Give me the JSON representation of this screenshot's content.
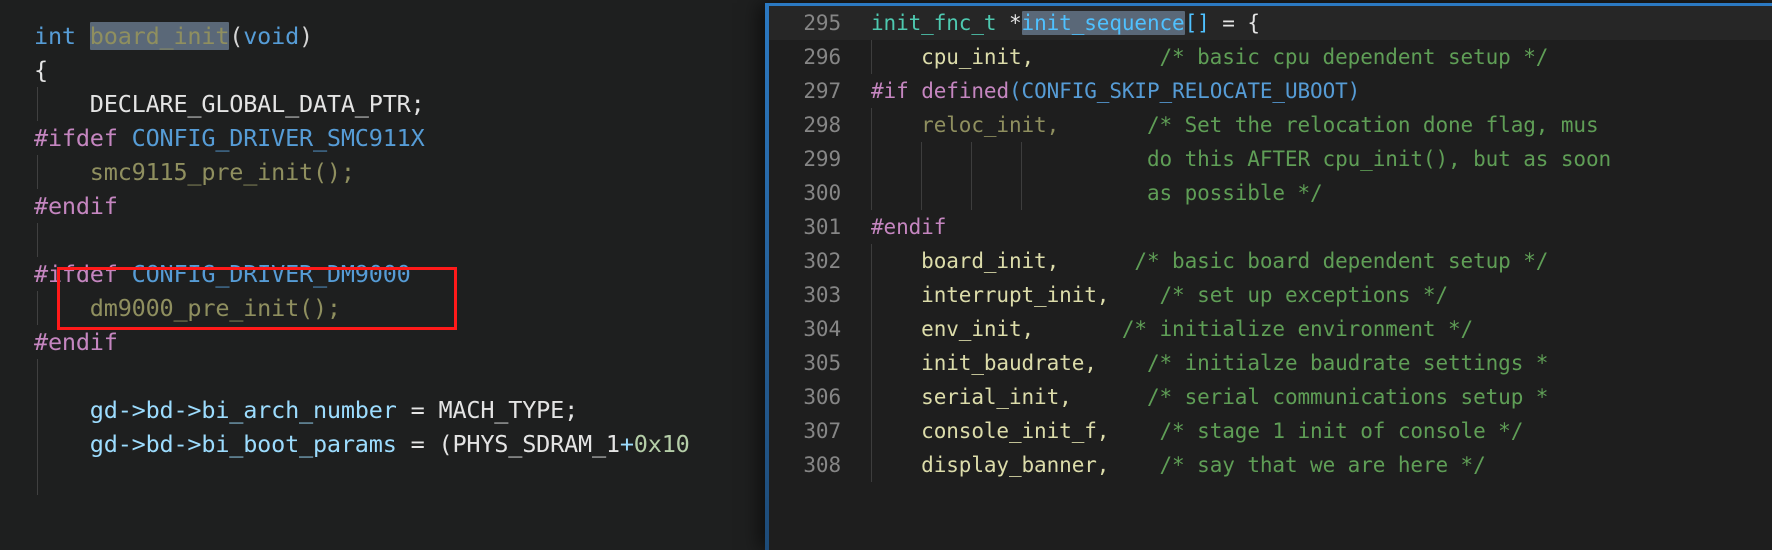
{
  "app": {
    "kind": "code-editor",
    "theme": "dark",
    "colors": {
      "background": "#1e1e1e",
      "left_background": "#1e1f1f",
      "peek_border": "#2b79c2",
      "annotation": "#ff1a1a",
      "selection_highlight": "#5a6878",
      "line_number": "#868686",
      "comment": "#5f9e56",
      "preprocessor": "#c586c0",
      "macro": "#569cd6",
      "function_name": "#dcdcaa",
      "typedef": "#4ec9b0",
      "variable": "#9cdcfe",
      "call": "#8f8f5f",
      "plain": "#d4d4d4"
    }
  },
  "left_editor": {
    "name": "board_init source",
    "highlighted_symbol": "board_init",
    "lines": [
      {
        "indent_guides": [],
        "tokens": [
          {
            "t": "int ",
            "c": "k-type"
          },
          {
            "t": "board_init",
            "c": "k-call",
            "hl": true
          },
          {
            "t": "(",
            "c": "k-punct"
          },
          {
            "t": "void",
            "c": "k-type"
          },
          {
            "t": ")",
            "c": "k-punct"
          }
        ]
      },
      {
        "indent_guides": [],
        "tokens": [
          {
            "t": "{",
            "c": "k-white"
          }
        ]
      },
      {
        "indent_guides": [
          0
        ],
        "tokens": [
          {
            "t": "    DECLARE_GLOBAL_DATA_PTR;",
            "c": "k-white"
          }
        ]
      },
      {
        "indent_guides": [],
        "tokens": [
          {
            "t": "#ifdef ",
            "c": "k-pre"
          },
          {
            "t": "CONFIG_DRIVER_SMC911X",
            "c": "k-macro"
          }
        ]
      },
      {
        "indent_guides": [
          0
        ],
        "tokens": [
          {
            "t": "    smc9115_pre_init();",
            "c": "k-call"
          }
        ]
      },
      {
        "indent_guides": [],
        "tokens": [
          {
            "t": "#endif",
            "c": "k-pre"
          }
        ]
      },
      {
        "indent_guides": [
          0
        ],
        "tokens": [
          {
            "t": "",
            "c": "k-plain"
          }
        ]
      },
      {
        "indent_guides": [],
        "tokens": [
          {
            "t": "#ifdef ",
            "c": "k-pre"
          },
          {
            "t": "CONFIG_DRIVER_DM9000",
            "c": "k-macro"
          }
        ]
      },
      {
        "indent_guides": [
          0
        ],
        "tokens": [
          {
            "t": "    dm9000_pre_init();",
            "c": "k-call"
          }
        ]
      },
      {
        "indent_guides": [],
        "tokens": [
          {
            "t": "#endif",
            "c": "k-pre"
          }
        ]
      },
      {
        "indent_guides": [
          0
        ],
        "tokens": [
          {
            "t": "",
            "c": "k-plain"
          }
        ]
      },
      {
        "indent_guides": [
          0
        ],
        "tokens": [
          {
            "t": "    gd->bd->bi_arch_number",
            "c": "k-ident"
          },
          {
            "t": " = ",
            "c": "k-white"
          },
          {
            "t": "MACH_TYPE",
            "c": "k-white"
          },
          {
            "t": ";",
            "c": "k-white"
          }
        ]
      },
      {
        "indent_guides": [
          0
        ],
        "tokens": [
          {
            "t": "    gd->bd->bi_boot_params",
            "c": "k-ident"
          },
          {
            "t": " = ",
            "c": "k-white"
          },
          {
            "t": "(PHYS_SDRAM_1",
            "c": "k-white"
          },
          {
            "t": "+",
            "c": "k-ident"
          },
          {
            "t": "0x10",
            "c": "k-num"
          }
        ]
      },
      {
        "indent_guides": [
          0
        ],
        "tokens": [
          {
            "t": "",
            "c": "k-plain"
          }
        ]
      }
    ]
  },
  "annotation": {
    "name": "red-highlight-rectangle",
    "color": "#ff1a1a",
    "encloses": "#ifdef CONFIG_DRIVER_DM9000 / dm9000_pre_init();"
  },
  "peek_panel": {
    "name": "peek-definition-init_sequence",
    "highlighted_symbol": "init_sequence",
    "current_line": 295,
    "lines": [
      {
        "no": "295",
        "current": true,
        "guides": [],
        "tokens": [
          {
            "t": "init_fnc_t",
            "c": "k-typedef"
          },
          {
            "t": " *",
            "c": "k-white"
          },
          {
            "t": "init_sequence",
            "c": "k-const",
            "hl": true
          },
          {
            "t": "[]",
            "c": "k-const"
          },
          {
            "t": " = ",
            "c": "k-white"
          },
          {
            "t": "{",
            "c": "k-white"
          }
        ]
      },
      {
        "no": "296",
        "current": false,
        "guides": [
          0
        ],
        "tokens": [
          {
            "t": "    cpu_init,",
            "c": "k-fnname"
          },
          {
            "t": "          ",
            "c": "k-plain"
          },
          {
            "t": "/* basic cpu dependent setup */",
            "c": "k-comment"
          }
        ]
      },
      {
        "no": "297",
        "current": false,
        "guides": [],
        "tokens": [
          {
            "t": "#if ",
            "c": "k-pre"
          },
          {
            "t": "defined",
            "c": "k-pre"
          },
          {
            "t": "(",
            "c": "k-macro"
          },
          {
            "t": "CONFIG_SKIP_RELOCATE_UBOOT",
            "c": "k-macro"
          },
          {
            "t": ")",
            "c": "k-macro"
          }
        ]
      },
      {
        "no": "298",
        "current": false,
        "guides": [
          0
        ],
        "tokens": [
          {
            "t": "    reloc_init,",
            "c": "k-call"
          },
          {
            "t": "       ",
            "c": "k-plain"
          },
          {
            "t": "/* Set the relocation done flag, mus",
            "c": "k-comment"
          }
        ]
      },
      {
        "no": "299",
        "current": false,
        "guides": [
          0,
          1,
          2,
          3
        ],
        "tokens": [
          {
            "t": "                      ",
            "c": "k-plain"
          },
          {
            "t": "do this AFTER cpu_init(), but as soon",
            "c": "k-comment"
          }
        ]
      },
      {
        "no": "300",
        "current": false,
        "guides": [
          0,
          1,
          2,
          3
        ],
        "tokens": [
          {
            "t": "                      ",
            "c": "k-plain"
          },
          {
            "t": "as possible */",
            "c": "k-comment"
          }
        ]
      },
      {
        "no": "301",
        "current": false,
        "guides": [],
        "tokens": [
          {
            "t": "#endif",
            "c": "k-pre"
          }
        ]
      },
      {
        "no": "302",
        "current": false,
        "guides": [
          0
        ],
        "tokens": [
          {
            "t": "    board_init,",
            "c": "k-fnname"
          },
          {
            "t": "      ",
            "c": "k-plain"
          },
          {
            "t": "/* basic board dependent setup */",
            "c": "k-comment"
          }
        ]
      },
      {
        "no": "303",
        "current": false,
        "guides": [
          0
        ],
        "tokens": [
          {
            "t": "    interrupt_init,",
            "c": "k-fnname"
          },
          {
            "t": "    ",
            "c": "k-plain"
          },
          {
            "t": "/* set up exceptions */",
            "c": "k-comment"
          }
        ]
      },
      {
        "no": "304",
        "current": false,
        "guides": [
          0
        ],
        "tokens": [
          {
            "t": "    env_init,",
            "c": "k-fnname"
          },
          {
            "t": "       ",
            "c": "k-plain"
          },
          {
            "t": "/* initialize environment */",
            "c": "k-comment"
          }
        ]
      },
      {
        "no": "305",
        "current": false,
        "guides": [
          0
        ],
        "tokens": [
          {
            "t": "    init_baudrate,",
            "c": "k-fnname"
          },
          {
            "t": "    ",
            "c": "k-plain"
          },
          {
            "t": "/* initialze baudrate settings *",
            "c": "k-comment"
          }
        ]
      },
      {
        "no": "306",
        "current": false,
        "guides": [
          0
        ],
        "tokens": [
          {
            "t": "    serial_init,",
            "c": "k-fnname"
          },
          {
            "t": "      ",
            "c": "k-plain"
          },
          {
            "t": "/* serial communications setup *",
            "c": "k-comment"
          }
        ]
      },
      {
        "no": "307",
        "current": false,
        "guides": [
          0
        ],
        "tokens": [
          {
            "t": "    console_init_f,",
            "c": "k-fnname"
          },
          {
            "t": "    ",
            "c": "k-plain"
          },
          {
            "t": "/* stage 1 init of console */",
            "c": "k-comment"
          }
        ]
      },
      {
        "no": "308",
        "current": false,
        "guides": [
          0
        ],
        "tokens": [
          {
            "t": "    display_banner,",
            "c": "k-fnname"
          },
          {
            "t": "    ",
            "c": "k-plain"
          },
          {
            "t": "/* say that we are here */",
            "c": "k-comment"
          }
        ]
      }
    ]
  }
}
